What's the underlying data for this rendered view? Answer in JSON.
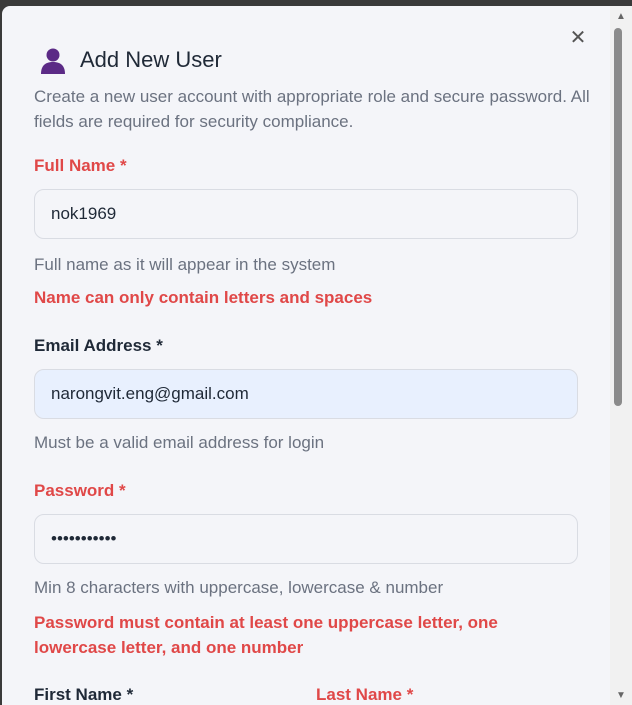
{
  "dialog": {
    "title": "Add New User",
    "description": "Create a new user account with appropriate role and secure password. All fields are required for security compliance.",
    "close_icon": "close-icon",
    "header_icon": "user-icon"
  },
  "fields": {
    "full_name": {
      "label": "Full Name *",
      "value": "nok1969",
      "help": "Full name as it will appear in the system",
      "error": "Name can only contain letters and spaces"
    },
    "email": {
      "label": "Email Address *",
      "value": "narongvit.eng@gmail.com",
      "help": "Must be a valid email address for login"
    },
    "password": {
      "label": "Password *",
      "value": "•••••••••••",
      "help": "Min 8 characters with uppercase, lowercase & number",
      "error": "Password must contain at least one uppercase letter, one lowercase letter, and one number"
    },
    "first_name": {
      "label": "First Name *"
    },
    "last_name": {
      "label": "Last Name *"
    }
  },
  "colors": {
    "error": "#e04848",
    "text": "#1f2937",
    "muted": "#6b7280",
    "icon": "#5b2a86"
  }
}
